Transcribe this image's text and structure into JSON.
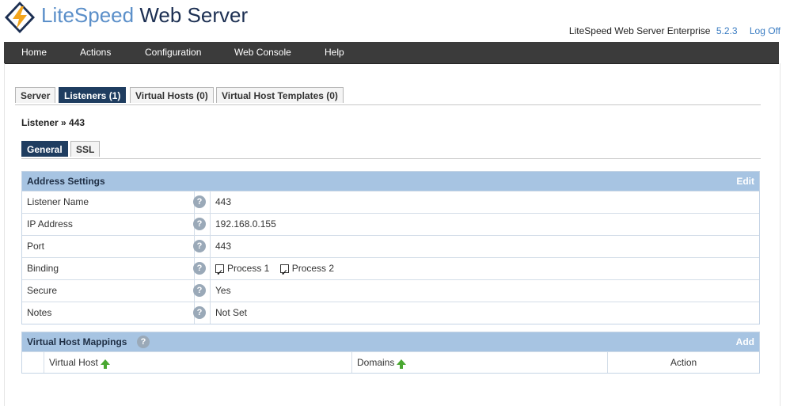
{
  "header": {
    "logo_lite": "LiteSpeed",
    "logo_ws": "Web Server",
    "product": "LiteSpeed Web Server Enterprise",
    "version": "5.2.3",
    "logoff": "Log Off"
  },
  "nav": {
    "items": [
      "Home",
      "Actions",
      "Configuration",
      "Web Console",
      "Help"
    ]
  },
  "tabs": [
    "Server",
    "Listeners (1)",
    "Virtual Hosts (0)",
    "Virtual Host Templates (0)"
  ],
  "breadcrumb": "Listener » 443",
  "subtabs": [
    "General",
    "SSL"
  ],
  "address": {
    "title": "Address Settings",
    "edit": "Edit",
    "rows": [
      {
        "label": "Listener Name",
        "value": "443"
      },
      {
        "label": "IP Address",
        "value": "192.168.0.155"
      },
      {
        "label": "Port",
        "value": "443"
      },
      {
        "label": "Binding",
        "value": ""
      },
      {
        "label": "Secure",
        "value": "Yes"
      },
      {
        "label": "Notes",
        "value": "Not Set"
      }
    ],
    "binding_options": [
      "Process 1",
      "Process 2"
    ]
  },
  "mappings": {
    "title": "Virtual Host Mappings",
    "add": "Add",
    "columns": [
      "Virtual Host",
      "Domains",
      "Action"
    ]
  },
  "colors": {
    "nav_bg": "#3b3b3b",
    "tab_active": "#1f3d60",
    "panel_head": "#a7c4e2",
    "link": "#3a7cc2",
    "sort_arrow": "#4aa832"
  }
}
